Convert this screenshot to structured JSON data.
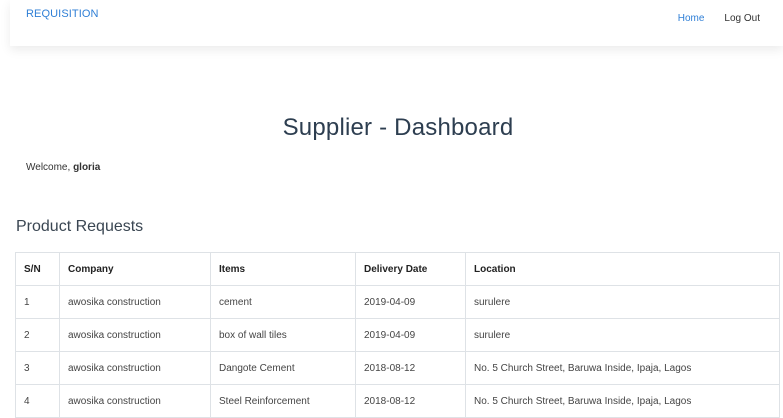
{
  "navbar": {
    "brand": "REQUISITION",
    "links": [
      {
        "label": "Home"
      },
      {
        "label": "Log Out"
      }
    ]
  },
  "page": {
    "title": "Supplier - Dashboard",
    "welcome_prefix": "Welcome, ",
    "username": "gloria",
    "section_title": "Product Requests"
  },
  "table": {
    "headers": [
      "S/N",
      "Company",
      "Items",
      "Delivery Date",
      "Location"
    ],
    "rows": [
      [
        "1",
        "awosika construction",
        "cement",
        "2019-04-09",
        "surulere"
      ],
      [
        "2",
        "awosika construction",
        "box of wall tiles",
        "2019-04-09",
        "surulere"
      ],
      [
        "3",
        "awosika construction",
        "Dangote Cement",
        "2018-08-12",
        "No. 5 Church Street, Baruwa Inside, Ipaja, Lagos"
      ],
      [
        "4",
        "awosika construction",
        "Steel Reinforcement",
        "2018-08-12",
        "No. 5 Church Street, Baruwa Inside, Ipaja, Lagos"
      ]
    ]
  },
  "colors": {
    "link": "#2f7fd6",
    "title": "#2d3e50",
    "border": "#dee2e6"
  }
}
